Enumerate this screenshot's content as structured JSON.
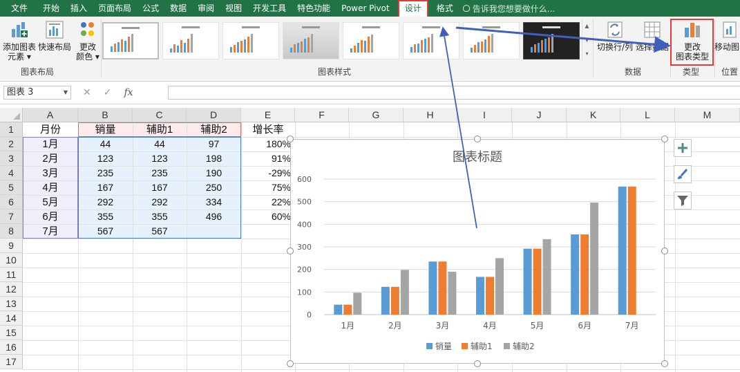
{
  "menu": {
    "items": [
      "文件",
      "开始",
      "插入",
      "页面布局",
      "公式",
      "数据",
      "审阅",
      "视图",
      "开发工具",
      "特色功能",
      "Power Pivot",
      "设计",
      "格式"
    ],
    "active_index": 11,
    "tell_me": "告诉我您想要做什么..."
  },
  "ribbon": {
    "add_element": [
      "添加图表",
      "元素 ▾"
    ],
    "quick_layout": "快速布局",
    "change_colors": [
      "更改",
      "颜色 ▾"
    ],
    "group_layout": "图表布局",
    "group_styles": "图表样式",
    "switch_row_col": "切换行/列",
    "select_data": "选择数据",
    "group_data": "数据",
    "change_type": [
      "更改",
      "图表类型"
    ],
    "group_type": "类型",
    "move_chart": "移动图表",
    "group_location": "位置",
    "colors": {
      "green": "#217346",
      "highlight": "#e53935",
      "arrow": "#3f5fbf"
    }
  },
  "formula": {
    "name_box": "图表 3",
    "fx": "fx",
    "cancel": "✕",
    "enter": "✓",
    "content": ""
  },
  "sheet": {
    "columns": [
      "A",
      "B",
      "C",
      "D",
      "E",
      "F",
      "G",
      "H",
      "I",
      "J",
      "K",
      "L",
      "M"
    ],
    "rows": [
      "1",
      "2",
      "3",
      "4",
      "5",
      "6",
      "7",
      "8",
      "9",
      "10",
      "11",
      "12",
      "13",
      "14",
      "15",
      "16",
      "17"
    ],
    "header": [
      "月份",
      "销量",
      "辅助1",
      "辅助2",
      "增长率"
    ],
    "data": [
      [
        "1月",
        "44",
        "44",
        "97",
        "180%"
      ],
      [
        "2月",
        "123",
        "123",
        "198",
        "91%"
      ],
      [
        "3月",
        "235",
        "235",
        "190",
        "-29%"
      ],
      [
        "4月",
        "167",
        "167",
        "250",
        "75%"
      ],
      [
        "5月",
        "292",
        "292",
        "334",
        "22%"
      ],
      [
        "6月",
        "355",
        "355",
        "496",
        "60%"
      ],
      [
        "7月",
        "567",
        "567",
        "",
        ""
      ]
    ]
  },
  "chart_data": {
    "type": "bar",
    "title": "图表标题",
    "categories": [
      "1月",
      "2月",
      "3月",
      "4月",
      "5月",
      "6月",
      "7月"
    ],
    "series": [
      {
        "name": "销量",
        "values": [
          44,
          123,
          235,
          167,
          292,
          355,
          567
        ],
        "color": "#5b9bd5"
      },
      {
        "name": "辅助1",
        "values": [
          44,
          123,
          235,
          167,
          292,
          355,
          567
        ],
        "color": "#ed7d31"
      },
      {
        "name": "辅助2",
        "values": [
          97,
          198,
          190,
          250,
          334,
          496,
          null
        ],
        "color": "#a5a5a5"
      }
    ],
    "yticks": [
      "0",
      "100",
      "200",
      "300",
      "400",
      "500",
      "600"
    ],
    "ylim": [
      0,
      600
    ],
    "grid": true,
    "legend": "bottom"
  },
  "chart_buttons": [
    "plus-icon",
    "brush-icon",
    "filter-icon"
  ]
}
